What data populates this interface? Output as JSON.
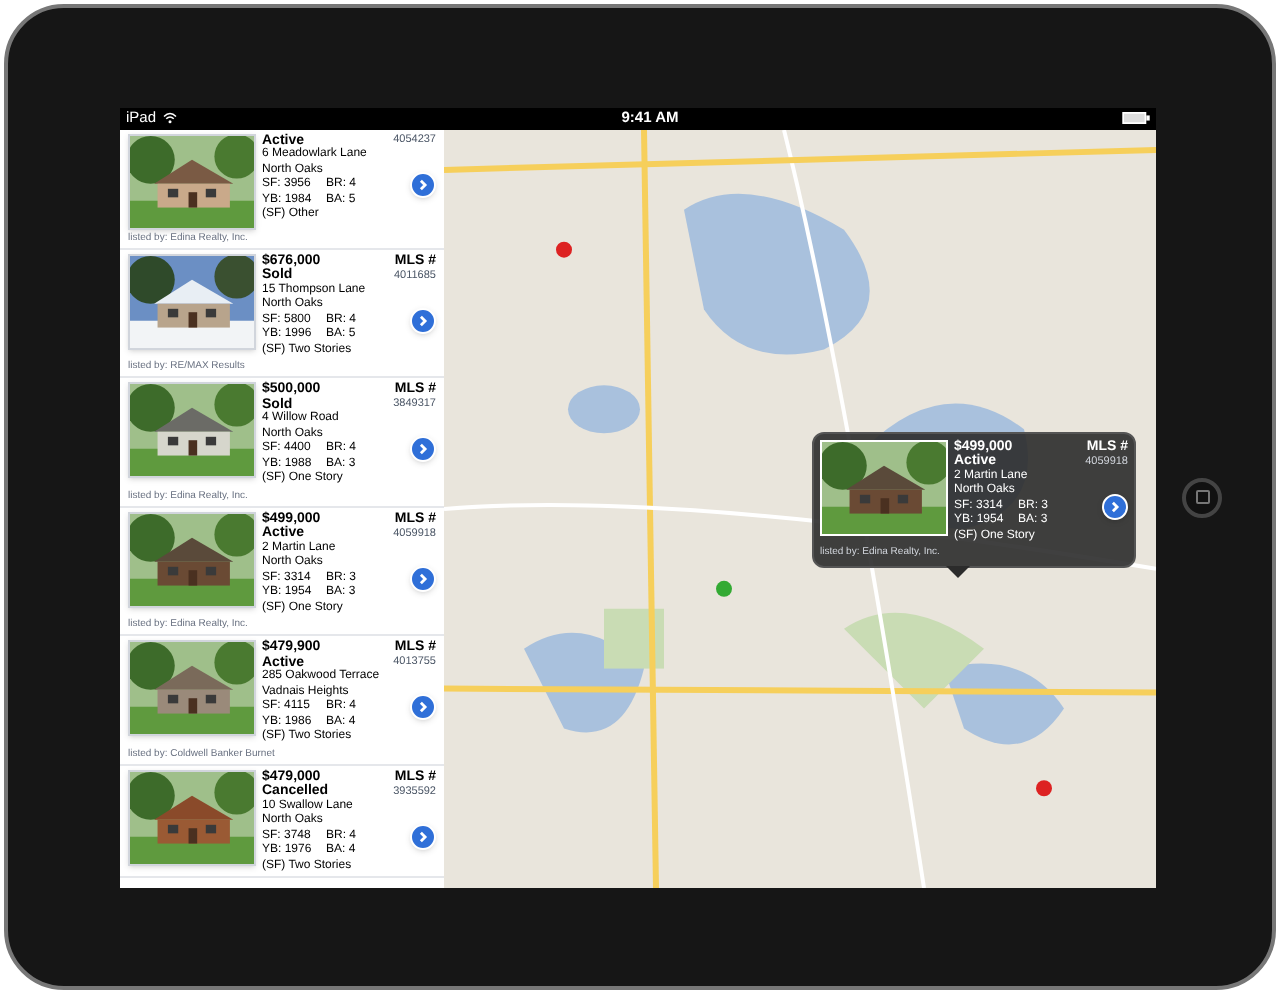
{
  "status_bar": {
    "device": "iPad",
    "time": "9:41 AM"
  },
  "listings": [
    {
      "status": "Active",
      "address": "6 Meadowlark Lane",
      "city": "North Oaks",
      "sf": "SF: 3956",
      "br": "BR: 4",
      "yb": "YB: 1984",
      "ba": "BA: 5",
      "style": "(SF) Other",
      "mls": "4054237",
      "listed_by": "listed by: Edina Realty, Inc."
    },
    {
      "price": "$676,000",
      "status": "Sold",
      "address": "15 Thompson Lane",
      "city": "North Oaks",
      "sf": "SF: 5800",
      "br": "BR: 4",
      "yb": "YB: 1996",
      "ba": "BA: 5",
      "style": "(SF) Two Stories",
      "mls_label": "MLS #",
      "mls": "4011685",
      "listed_by": "listed by: RE/MAX Results"
    },
    {
      "price": "$500,000",
      "status": "Sold",
      "address": "4 Willow Road",
      "city": "North Oaks",
      "sf": "SF: 4400",
      "br": "BR: 4",
      "yb": "YB: 1988",
      "ba": "BA: 3",
      "style": "(SF) One Story",
      "mls_label": "MLS #",
      "mls": "3849317",
      "listed_by": "listed by: Edina Realty, Inc."
    },
    {
      "price": "$499,000",
      "status": "Active",
      "address": "2 Martin Lane",
      "city": "North Oaks",
      "sf": "SF: 3314",
      "br": "BR: 3",
      "yb": "YB: 1954",
      "ba": "BA: 3",
      "style": "(SF) One Story",
      "mls_label": "MLS #",
      "mls": "4059918",
      "listed_by": "listed by: Edina Realty, Inc."
    },
    {
      "price": "$479,900",
      "status": "Active",
      "address": "285 Oakwood Terrace",
      "city": "Vadnais Heights",
      "sf": "SF: 4115",
      "br": "BR: 4",
      "yb": "YB: 1986",
      "ba": "BA: 4",
      "style": "(SF) Two Stories",
      "mls_label": "MLS #",
      "mls": "4013755",
      "listed_by": "listed by: Coldwell Banker Burnet"
    },
    {
      "price": "$479,000",
      "status": "Cancelled",
      "address": "10 Swallow Lane",
      "city": "North Oaks",
      "sf": "SF: 3748",
      "br": "BR: 4",
      "yb": "YB: 1976",
      "ba": "BA: 4",
      "style": "(SF) Two Stories",
      "mls_label": "MLS #",
      "mls": "3935592"
    }
  ],
  "map_popup": {
    "price": "$499,000",
    "status": "Active",
    "address": "2 Martin Lane",
    "city": "North Oaks",
    "sf": "SF: 3314",
    "br": "BR: 3",
    "yb": "YB: 1954",
    "ba": "BA: 3",
    "style": "(SF) One Story",
    "mls_label": "MLS #",
    "mls": "4059918",
    "listed_by": "listed by: Edina Realty, Inc."
  }
}
